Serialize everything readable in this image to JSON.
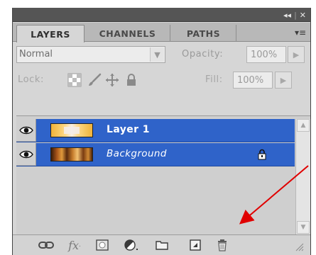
{
  "panel": {
    "window_buttons": {
      "collapse": "◂◂",
      "close": "✕"
    },
    "tabs": [
      {
        "label": "LAYERS",
        "active": true
      },
      {
        "label": "CHANNELS",
        "active": false
      },
      {
        "label": "PATHS",
        "active": false
      }
    ],
    "menu_icon": "▾≡"
  },
  "blend": {
    "mode": "Normal",
    "opacity_label": "Opacity:",
    "opacity_value": "100%"
  },
  "lock": {
    "label": "Lock:",
    "fill_label": "Fill:",
    "fill_value": "100%",
    "icons": [
      "lock-transparent-icon",
      "lock-image-pixels-icon",
      "lock-position-icon",
      "lock-all-icon"
    ]
  },
  "layers": [
    {
      "name": "Layer 1",
      "visible": true,
      "selected": true,
      "locked": false,
      "italic": false
    },
    {
      "name": "Background",
      "visible": true,
      "selected": true,
      "locked": true,
      "italic": true
    }
  ],
  "toolbar": {
    "icons": [
      "link-layers-icon",
      "layer-style-icon",
      "layer-mask-icon",
      "adjustment-layer-icon",
      "new-group-icon",
      "new-layer-icon",
      "delete-layer-icon"
    ]
  },
  "colors": {
    "selection": "#2f63c9",
    "panel_bg": "#d6d6d6",
    "annotation_arrow": "#e00000"
  }
}
